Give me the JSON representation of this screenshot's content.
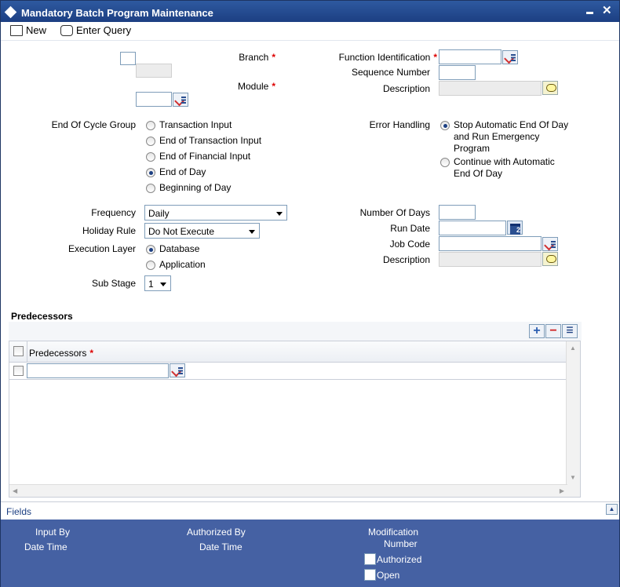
{
  "window": {
    "title": "Mandatory Batch Program Maintenance"
  },
  "toolbar": {
    "new_label": "New",
    "enter_query_label": "Enter Query"
  },
  "form": {
    "branch_label": "Branch",
    "module_label": "Module",
    "function_id_label": "Function Identification",
    "sequence_number_label": "Sequence Number",
    "description_label": "Description",
    "required_mark": "*",
    "eoc_group_label": "End Of Cycle Group",
    "eoc_options": [
      "Transaction Input",
      "End of Transaction Input",
      "End of Financial Input",
      "End of Day",
      "Beginning of Day"
    ],
    "eoc_selected": "End of Day",
    "error_handling_label": "Error Handling",
    "error_options": [
      "Stop Automatic End Of Day and Run Emergency Program",
      "Continue with Automatic End Of Day"
    ],
    "frequency_label": "Frequency",
    "frequency_value": "Daily",
    "holiday_rule_label": "Holiday Rule",
    "holiday_rule_value": "Do Not Execute",
    "execution_layer_label": "Execution Layer",
    "execution_options": [
      "Database",
      "Application"
    ],
    "sub_stage_label": "Sub Stage",
    "sub_stage_value": "1",
    "number_of_days_label": "Number Of Days",
    "run_date_label": "Run Date",
    "job_code_label": "Job Code",
    "job_description_label": "Description"
  },
  "predecessors": {
    "section_title": "Predecessors",
    "column_header": "Predecessors"
  },
  "fields_bar": {
    "label": "Fields"
  },
  "footer": {
    "input_by": "Input By",
    "date_time_1": "Date Time",
    "authorized_by": "Authorized By",
    "date_time_2": "Date Time",
    "modification": "Modification",
    "number": "Number",
    "authorized": "Authorized",
    "open": "Open"
  }
}
